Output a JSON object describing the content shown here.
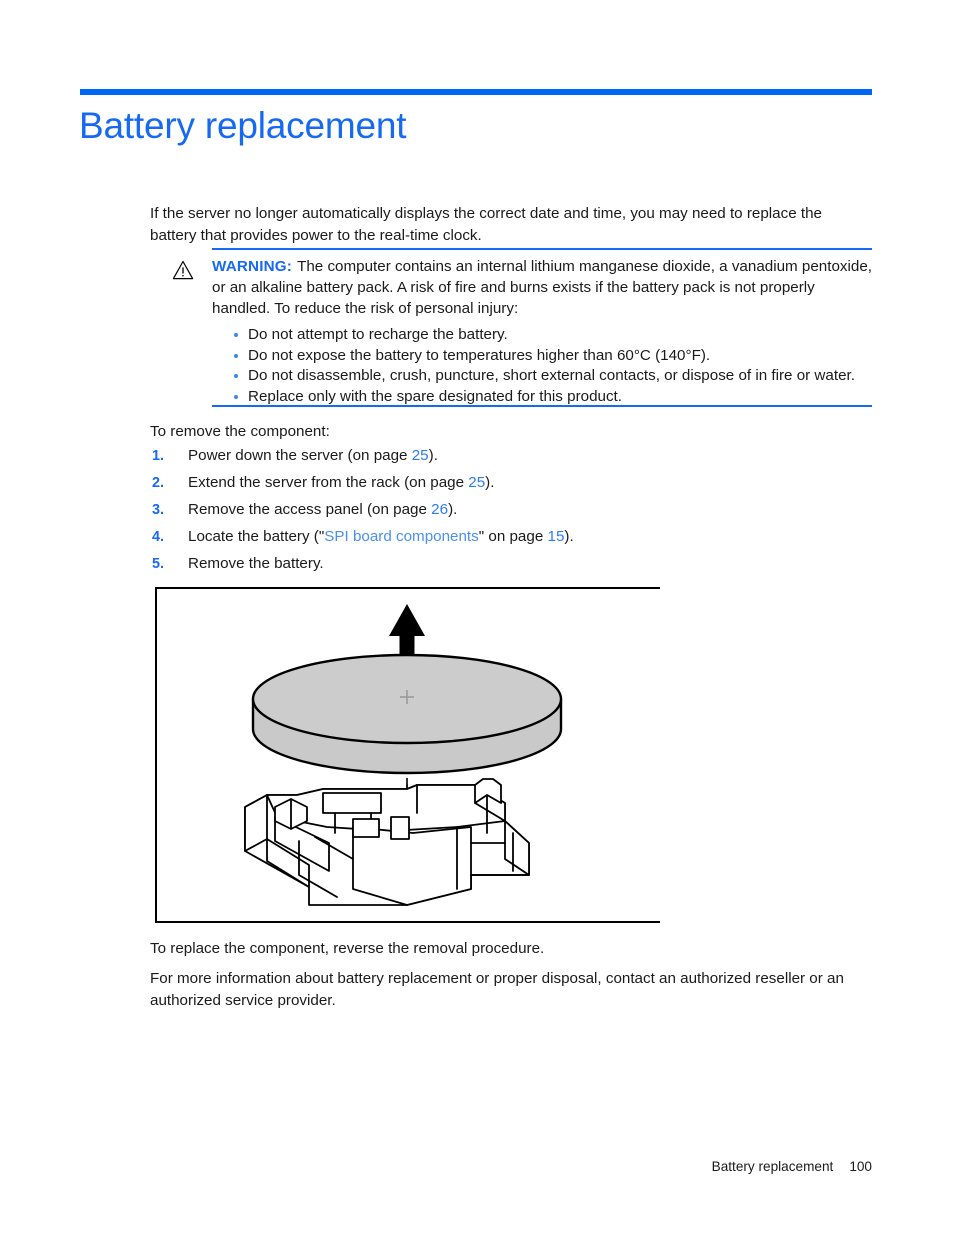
{
  "document": {
    "title": "Battery replacement",
    "accent_color": "#1669f2",
    "rule_color": "#0066f5",
    "text_color": "#1a1a1a"
  },
  "intro": {
    "paragraph": "If the server no longer automatically displays the correct date and time, you may need to replace the battery that provides power to the real-time clock."
  },
  "warning": {
    "icon": "warning-triangle-icon",
    "label": "WARNING:",
    "lead": "The computer contains an internal lithium manganese dioxide, a vanadium pentoxide, or an alkaline battery pack. A risk of fire and burns exists if the battery pack is not properly handled. To reduce the risk of personal injury:",
    "bullets": [
      "Do not attempt to recharge the battery.",
      "Do not expose the battery to temperatures higher than 60°C (140°F).",
      "Do not disassemble, crush, puncture, short external contacts, or dispose of in fire or water.",
      "Replace only with the spare designated for this product."
    ]
  },
  "procedure": {
    "intro": "To remove the component:",
    "steps": [
      {
        "number": "1.",
        "prefix": "Power down the server (on page ",
        "link": "25",
        "suffix": ")."
      },
      {
        "number": "2.",
        "prefix": "Extend the server from the rack (on page ",
        "link": "25",
        "suffix": ")."
      },
      {
        "number": "3.",
        "prefix": "Remove the access panel (on page ",
        "link": "26",
        "suffix": ")."
      },
      {
        "number": "4.",
        "prefix": "Locate the battery (\"",
        "link_title": "SPI board components",
        "mid": "\" on page ",
        "link": "15",
        "suffix": ")."
      },
      {
        "number": "5.",
        "prefix": "Remove the battery.",
        "link": "",
        "suffix": ""
      }
    ]
  },
  "figure": {
    "name": "battery-removal-illustration",
    "caption": "",
    "parts": {
      "arrow": "up-arrow-removal-direction",
      "battery": "coin-cell-battery",
      "battery_polarity_mark": "+",
      "socket": "battery-socket-holder",
      "alignment_line": "dashed-alignment-line"
    },
    "colors": {
      "battery_fill": "#c9c9c9",
      "outline": "#000000"
    }
  },
  "closing": {
    "replace_note": "To replace the component, reverse the removal procedure.",
    "more_info": "For more information about battery replacement or proper disposal, contact an authorized reseller or an authorized service provider."
  },
  "footer": {
    "section": "Battery replacement",
    "page_number": "100"
  }
}
